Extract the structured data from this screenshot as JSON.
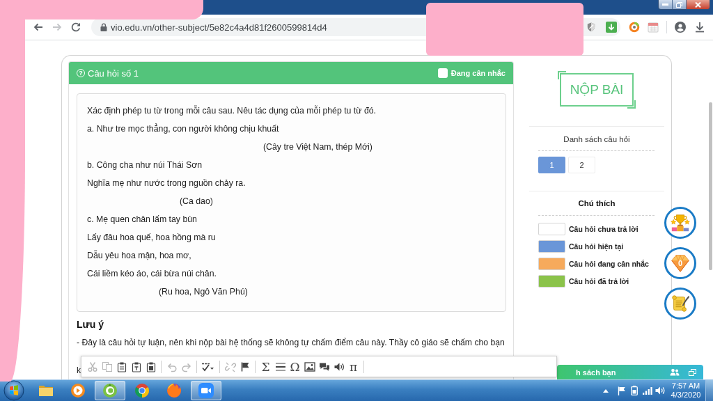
{
  "browser": {
    "nav_buttons": [
      {
        "kind": "back",
        "disabled": false
      },
      {
        "kind": "forward",
        "disabled": true
      },
      {
        "kind": "reload",
        "disabled": false
      }
    ],
    "url": "vio.edu.vn/other-subject/5e82c4a4d81f2600599814d4"
  },
  "question": {
    "icon": "?",
    "title": "Câu hỏi số 1",
    "flag_label": "Đang cân nhắc",
    "flagged": false,
    "lines": [
      {
        "kind": "prompt",
        "text": "Xác định phép tu từ trong mỗi câu sau. Nêu tác dụng của mỗi phép tu từ đó."
      },
      {
        "kind": "verse",
        "text": "a. Như tre mọc thẳng, con người không chịu khuất"
      },
      {
        "kind": "source",
        "text": "(Cây tre Việt Nam, thép Mới)"
      },
      {
        "kind": "verse",
        "text": "b. Công cha như núi Thái Sơn"
      },
      {
        "kind": "verse",
        "text": "Nghĩa mẹ như nước trong nguồn chảy ra."
      },
      {
        "kind": "source",
        "text": "(Ca dao)"
      },
      {
        "kind": "verse",
        "text": "c. Mẹ quen chân lấm tay bùn"
      },
      {
        "kind": "verse",
        "text": "Lấy đâu hoa quế, hoa hồng mà ru"
      },
      {
        "kind": "verse",
        "text": "Dẫu yêu hoa mận, hoa mơ,"
      },
      {
        "kind": "verse",
        "text": "Cái liềm kéo áo, cái bừa núi chân."
      },
      {
        "kind": "source",
        "text": "(Ru hoa, Ngô Văn Phú)"
      }
    ]
  },
  "note": {
    "title": "Lưu ý",
    "lines": [
      "- Đây là câu hỏi tự luận, nên khi nộp bài hệ thống sẽ không tự chấm điểm câu này. Thầy cô giáo sẽ chấm cho bạn",
      "k"
    ]
  },
  "editor_toolbar": {
    "groups": [
      [
        {
          "kind": "cut",
          "disabled": true
        },
        {
          "kind": "copy",
          "disabled": true
        },
        {
          "kind": "paste",
          "disabled": false
        },
        {
          "kind": "paste-text",
          "disabled": false
        },
        {
          "kind": "paste-word",
          "disabled": false
        }
      ],
      [
        {
          "kind": "undo",
          "disabled": true
        },
        {
          "kind": "redo",
          "disabled": true
        }
      ],
      [
        {
          "kind": "spellcheck",
          "disabled": false
        }
      ],
      [
        {
          "kind": "unlink",
          "disabled": true
        },
        {
          "kind": "anchor",
          "disabled": false
        }
      ],
      [
        {
          "kind": "symbol",
          "label": "Σ",
          "disabled": false
        },
        {
          "kind": "horizontal-rule",
          "disabled": false
        },
        {
          "kind": "symbol",
          "label": "Ω",
          "disabled": false
        },
        {
          "kind": "image",
          "disabled": false
        },
        {
          "kind": "comment",
          "disabled": false
        },
        {
          "kind": "audio",
          "disabled": false
        },
        {
          "kind": "symbol",
          "label": "π",
          "disabled": false
        }
      ]
    ]
  },
  "sidebar": {
    "submit": "NỘP BÀI",
    "question_list": {
      "title": "Danh sách câu hỏi",
      "items": [
        {
          "label": "1",
          "selected": true
        },
        {
          "label": "2",
          "selected": false
        }
      ]
    },
    "legend": {
      "title": "Chú thích",
      "items": [
        {
          "label": "Câu hỏi chưa trả lời",
          "color": "#ffffff"
        },
        {
          "label": "Câu hỏi hiện tại",
          "color": "#6a96d8"
        },
        {
          "label": "Câu hỏi đang cân nhắc",
          "color": "#f6aa5c"
        },
        {
          "label": "Câu hỏi đã trả lời",
          "color": "#8bc34a"
        }
      ]
    }
  },
  "floating_buttons": [
    {
      "kind": "trophy"
    },
    {
      "kind": "diamond",
      "count": "0"
    },
    {
      "kind": "scroll"
    }
  ],
  "chat_bar": {
    "label": "h sách bạn"
  },
  "taskbar": {
    "apps": [
      {
        "kind": "folder",
        "active": false
      },
      {
        "kind": "media",
        "active": false
      },
      {
        "kind": "swirl-browser",
        "active": true
      },
      {
        "kind": "round-browser",
        "active": false
      },
      {
        "kind": "fox-browser",
        "active": false
      },
      {
        "kind": "video-call",
        "active": true
      }
    ],
    "time": "7:57 AM",
    "date": "4/3/2020"
  }
}
